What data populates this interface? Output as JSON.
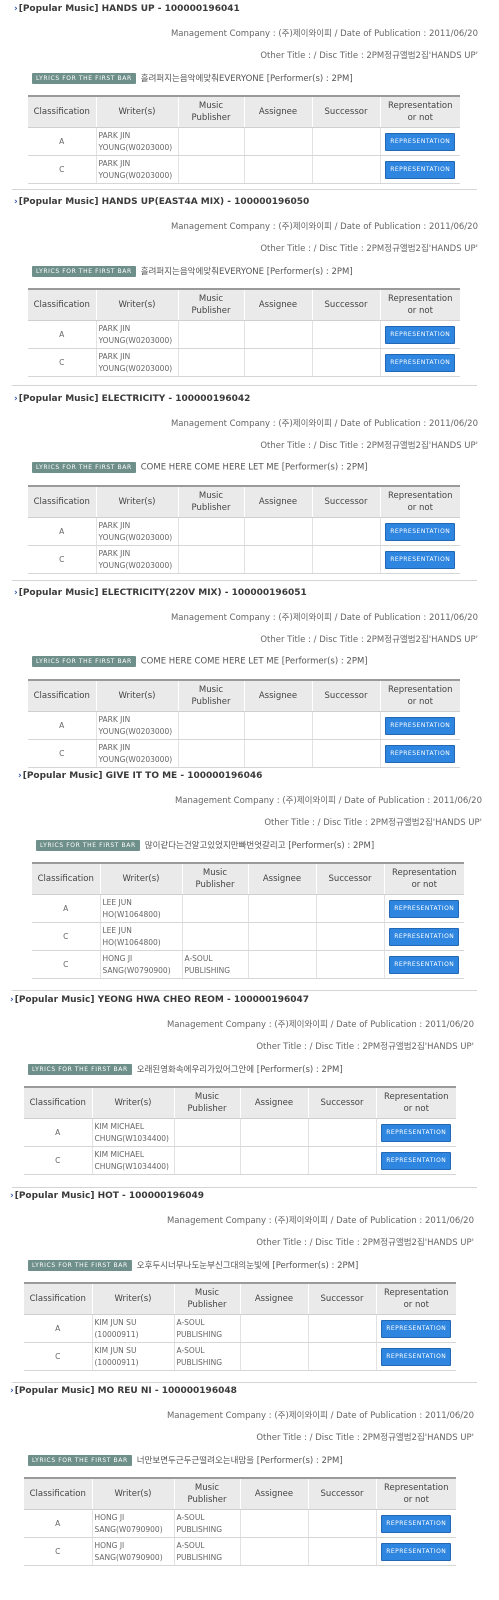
{
  "table_headers": [
    "Classification",
    "Writer(s)",
    "Music Publisher",
    "Assignee",
    "Successor",
    "Representation or not"
  ],
  "lyrics_badge": "LYRICS FOR THE FIRST BAR",
  "representation_label": "REPRESENTATION",
  "entries": [
    {
      "title": "[Popular Music] HANDS UP - 100000196041",
      "management": "Management Company : (주)제이와이피 / Date of Publication : 2011/06/20",
      "other_title": "Other Title : / Disc Title : 2PM정규앨범2집'HANDS UP'",
      "lyrics": "흘려퍼지는음악에맞춰EVERYONE [Performer(s) : 2PM]",
      "rows": [
        {
          "classification": "A",
          "writer": "PARK JIN YOUNG(W0203000)",
          "publisher": "",
          "assignee": "",
          "successor": ""
        },
        {
          "classification": "C",
          "writer": "PARK JIN YOUNG(W0203000)",
          "publisher": "",
          "assignee": "",
          "successor": ""
        }
      ]
    },
    {
      "title": "[Popular Music] HANDS UP(EAST4A MIX) - 100000196050",
      "management": "Management Company : (주)제이와이피 / Date of Publication : 2011/06/20",
      "other_title": "Other Title : / Disc Title : 2PM정규앨범2집'HANDS UP'",
      "lyrics": "흘려퍼지는음악에맞춰EVERYONE [Performer(s) : 2PM]",
      "rows": [
        {
          "classification": "A",
          "writer": "PARK JIN YOUNG(W0203000)",
          "publisher": "",
          "assignee": "",
          "successor": ""
        },
        {
          "classification": "C",
          "writer": "PARK JIN YOUNG(W0203000)",
          "publisher": "",
          "assignee": "",
          "successor": ""
        }
      ]
    },
    {
      "title": "[Popular Music] ELECTRICITY - 100000196042",
      "management": "Management Company : (주)제이와이피 / Date of Publication : 2011/06/20",
      "other_title": "Other Title : / Disc Title : 2PM정규앨범2집'HANDS UP'",
      "lyrics": "COME HERE COME HERE LET ME [Performer(s) : 2PM]",
      "rows": [
        {
          "classification": "A",
          "writer": "PARK JIN YOUNG(W0203000)",
          "publisher": "",
          "assignee": "",
          "successor": ""
        },
        {
          "classification": "C",
          "writer": "PARK JIN YOUNG(W0203000)",
          "publisher": "",
          "assignee": "",
          "successor": ""
        }
      ]
    },
    {
      "title": "[Popular Music] ELECTRICITY(220V MIX) - 100000196051",
      "management": "Management Company : (주)제이와이피 / Date of Publication : 2011/06/20",
      "other_title": "Other Title : / Disc Title : 2PM정규앨범2집'HANDS UP'",
      "lyrics": "COME HERE COME HERE LET ME [Performer(s) : 2PM]",
      "rows": [
        {
          "classification": "A",
          "writer": "PARK JIN YOUNG(W0203000)",
          "publisher": "",
          "assignee": "",
          "successor": ""
        },
        {
          "classification": "C",
          "writer": "PARK JIN YOUNG(W0203000)",
          "publisher": "",
          "assignee": "",
          "successor": ""
        }
      ]
    },
    {
      "title": "[Popular Music] GIVE IT TO ME - 100000196046",
      "management": "Management Company : (주)제이와이피 / Date of Publication : 2011/06/20",
      "other_title": "Other Title : / Disc Title : 2PM정규앨범2집'HANDS UP'",
      "lyrics": "많이같다는건알고있었지만빠번엇갈리고 [Performer(s) : 2PM]",
      "rows": [
        {
          "classification": "A",
          "writer": "LEE JUN HO(W1064800)",
          "publisher": "",
          "assignee": "",
          "successor": ""
        },
        {
          "classification": "C",
          "writer": "LEE JUN HO(W1064800)",
          "publisher": "",
          "assignee": "",
          "successor": ""
        },
        {
          "classification": "C",
          "writer": "HONG JI SANG(W0790900)",
          "publisher": "A-SOUL PUBLISHING",
          "assignee": "",
          "successor": ""
        }
      ]
    },
    {
      "title": "[Popular Music] YEONG HWA CHEO REOM - 100000196047",
      "management": "Management Company : (주)제이와이피 / Date of Publication : 2011/06/20",
      "other_title": "Other Title : / Disc Title : 2PM정규앨범2집'HANDS UP'",
      "lyrics": "오래된영화속에우리가있어그안에 [Performer(s) : 2PM]",
      "rows": [
        {
          "classification": "A",
          "writer": "KIM MICHAEL CHUNG(W1034400)",
          "publisher": "",
          "assignee": "",
          "successor": ""
        },
        {
          "classification": "C",
          "writer": "KIM MICHAEL CHUNG(W1034400)",
          "publisher": "",
          "assignee": "",
          "successor": ""
        }
      ]
    },
    {
      "title": "[Popular Music] HOT - 100000196049",
      "management": "Management Company : (주)제이와이피 / Date of Publication : 2011/06/20",
      "other_title": "Other Title : / Disc Title : 2PM정규앨범2집'HANDS UP'",
      "lyrics": "오후두시너무나도눈부신그대의눈빛에 [Performer(s) : 2PM]",
      "rows": [
        {
          "classification": "A",
          "writer": "KIM JUN SU (10000911)",
          "publisher": "A-SOUL PUBLISHING",
          "assignee": "",
          "successor": ""
        },
        {
          "classification": "C",
          "writer": "KIM JUN SU (10000911)",
          "publisher": "A-SOUL PUBLISHING",
          "assignee": "",
          "successor": ""
        }
      ]
    },
    {
      "title": "[Popular Music] MO REU NI - 100000196048",
      "management": "Management Company : (주)제이와이피 / Date of Publication : 2011/06/20",
      "other_title": "Other Title : / Disc Title : 2PM정규앨범2집'HANDS UP'",
      "lyrics": "너만보면두근두근떨려오는내맘을 [Performer(s) : 2PM]",
      "rows": [
        {
          "classification": "A",
          "writer": "HONG JI SANG(W0790900)",
          "publisher": "A-SOUL PUBLISHING",
          "assignee": "",
          "successor": ""
        },
        {
          "classification": "C",
          "writer": "HONG JI SANG(W0790900)",
          "publisher": "A-SOUL PUBLISHING",
          "assignee": "",
          "successor": ""
        }
      ]
    }
  ]
}
